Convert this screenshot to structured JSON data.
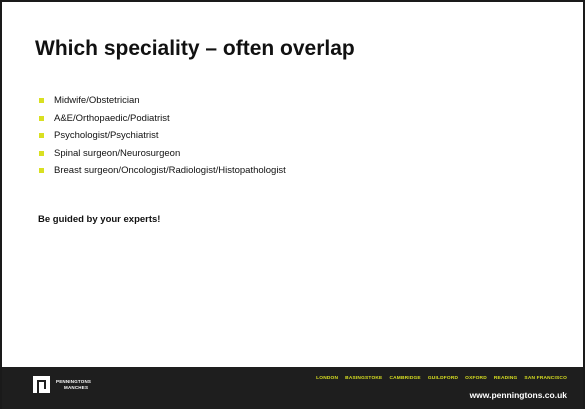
{
  "slide": {
    "title": "Which speciality – often overlap",
    "bullets": [
      "Midwife/Obstetrician",
      "A&E/Orthopaedic/Podiatrist",
      "Psychologist/Psychiatrist",
      "Spinal surgeon/Neurosurgeon",
      "Breast surgeon/Oncologist/Radiologist/Histopathologist"
    ],
    "note": "Be guided by your experts!"
  },
  "footer": {
    "logo_line1": "PENNINGTONS",
    "logo_line2": "MANCHES",
    "offices": [
      "LONDON",
      "BASINGSTOKE",
      "CAMBRIDGE",
      "GUILDFORD",
      "OXFORD",
      "READING",
      "SAN FRANCISCO"
    ],
    "url": "www.penningtons.co.uk"
  },
  "colors": {
    "accent": "#d9e021",
    "footer_bg": "#1e1e1e",
    "text": "#111111"
  },
  "icons": {
    "bullet": "square-bullet-icon",
    "logo": "penningtons-logo-icon"
  }
}
